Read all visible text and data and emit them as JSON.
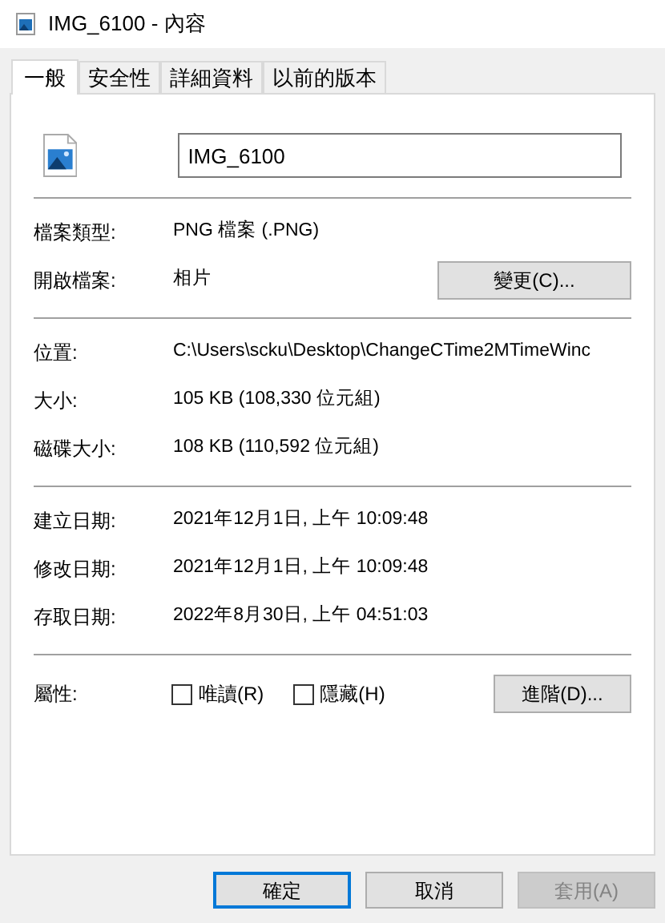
{
  "window": {
    "title": "IMG_6100 - 內容"
  },
  "tabs": [
    {
      "label": "一般",
      "selected": true
    },
    {
      "label": "安全性",
      "selected": false
    },
    {
      "label": "詳細資料",
      "selected": false
    },
    {
      "label": "以前的版本",
      "selected": false
    }
  ],
  "file_name": "IMG_6100",
  "sections": [
    {
      "rows": [
        {
          "label": "檔案類型:",
          "value": "PNG 檔案 (.PNG)"
        },
        {
          "label": "開啟檔案:",
          "value": "相片",
          "button": "變更(C)..."
        }
      ]
    },
    {
      "rows": [
        {
          "label": "位置:",
          "value": "C:\\Users\\scku\\Desktop\\ChangeCTime2MTimeWinc"
        },
        {
          "label": "大小:",
          "value": "105 KB (108,330 位元組)"
        },
        {
          "label": "磁碟大小:",
          "value": "108 KB (110,592 位元組)"
        }
      ]
    },
    {
      "rows": [
        {
          "label": "建立日期:",
          "value": "2021年12月1日, 上午 10:09:48"
        },
        {
          "label": "修改日期:",
          "value": "2021年12月1日, 上午 10:09:48"
        },
        {
          "label": "存取日期:",
          "value": "2022年8月30日, 上午 04:51:03"
        }
      ]
    }
  ],
  "attributes": {
    "label": "屬性:",
    "checkboxes": [
      {
        "label": "唯讀(R)",
        "checked": false
      },
      {
        "label": "隱藏(H)",
        "checked": false
      }
    ],
    "button": "進階(D)..."
  },
  "buttons": [
    {
      "label": "確定",
      "default": true,
      "disabled": false
    },
    {
      "label": "取消",
      "default": false,
      "disabled": false
    },
    {
      "label": "套用(A)",
      "default": false,
      "disabled": true
    }
  ]
}
